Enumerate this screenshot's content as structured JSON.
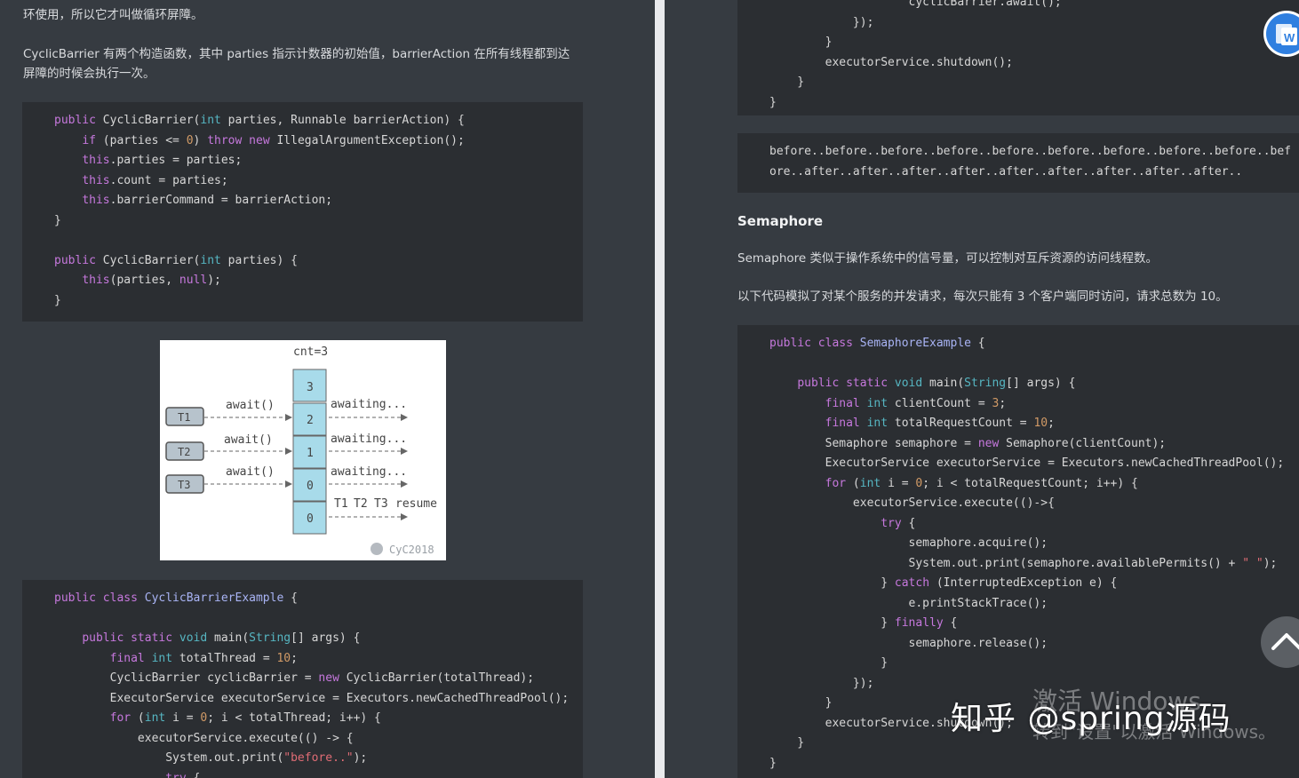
{
  "left": {
    "intro_text": "环使用，所以它才叫做循环屏障。",
    "constructor_desc": "CyclicBarrier 有两个构造函数，其中 parties 指示计数器的初始值，barrierAction 在所有线程都到达屏障的时候会执行一次。",
    "diagram": {
      "cnt_label": "cnt=3",
      "counter_cells": [
        "3",
        "2",
        "1",
        "0",
        "0"
      ],
      "threads": [
        "T1",
        "T2",
        "T3"
      ],
      "await_labels": [
        "await()",
        "await()",
        "await()"
      ],
      "awaiting_labels": [
        "awaiting...",
        "awaiting...",
        "awaiting..."
      ],
      "resume_label": "resume",
      "watermark": "CyC2018"
    }
  },
  "right": {
    "output_line_1": "before..before..before..before..before..before..before..before..before..bef",
    "output_line_2": "ore..after..after..after..after..after..after..after..after..after..",
    "semaphore_heading": "Semaphore",
    "semaphore_desc": "Semaphore 类似于操作系统中的信号量，可以控制对互斥资源的访问线程数。",
    "semaphore_example_desc": "以下代码模拟了对某个服务的并发请求，每次只能有 3 个客户端同时访问，请求总数为 10。"
  },
  "overlay": {
    "watermark_text": "知乎 @spring源码",
    "windows_activate_1": "激活 Windows",
    "windows_activate_2": "转到\"设置\"以激活 Windows。",
    "word_icon_letter": "W"
  },
  "colors": {
    "page_bg": "#363b41",
    "code_bg": "#2b2e32",
    "keyword": "#c678dd",
    "type": "#56b6c2",
    "class_name": "#a9b4f5",
    "number": "#d19a66",
    "string": "#e06c75",
    "counter_cell": "#a8dbea",
    "thread_box": "#b7c3cc"
  }
}
